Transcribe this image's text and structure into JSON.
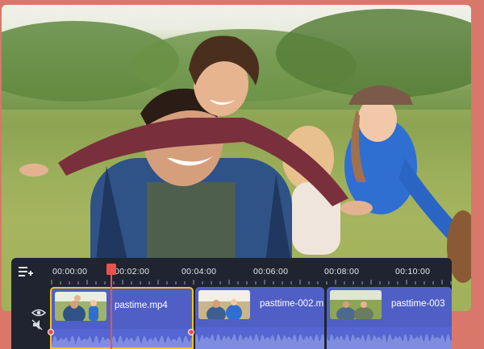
{
  "timeline": {
    "ruler_labels": [
      "00:00:00",
      "00:02:00",
      "00:04:00",
      "00:06:00",
      "00:08:00",
      "00:10:00"
    ],
    "clips": [
      {
        "label": "pastime.mp4",
        "selected": true
      },
      {
        "label": "pasttime-002.m",
        "selected": false
      },
      {
        "label": "pasttime-003",
        "selected": false
      }
    ]
  },
  "icons": {
    "timeline_menu": "add-track-icon",
    "visibility": "eye-icon",
    "mute": "mute-icon",
    "playhead": "playhead-marker-icon"
  },
  "colors": {
    "background": "#d9776a",
    "timeline_bg": "#1f2430",
    "clip_fill": "#4f5fc5",
    "selection": "#f3c21b",
    "playhead": "#e8534d"
  }
}
